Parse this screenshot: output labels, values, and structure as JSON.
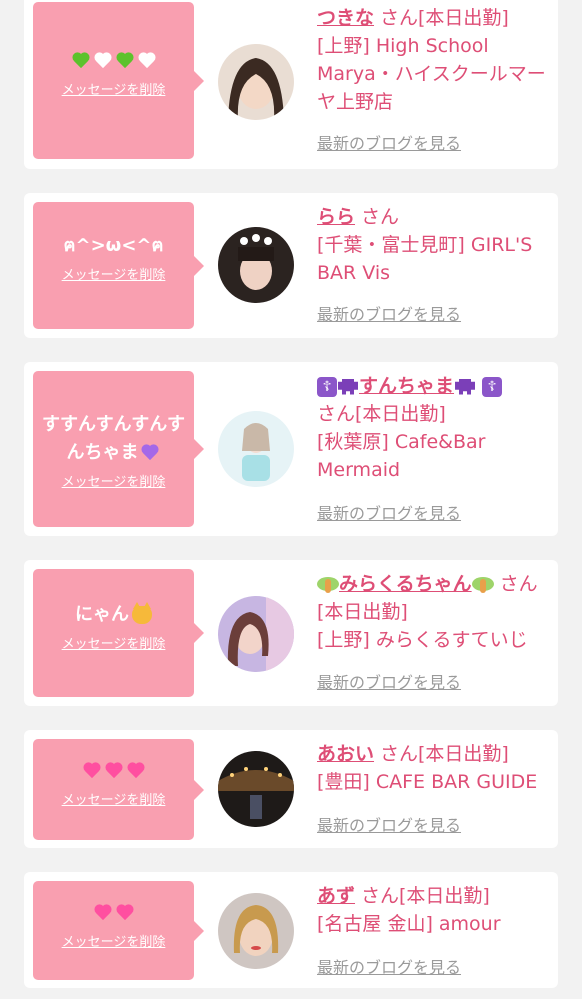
{
  "common": {
    "delete_label": "メッセージを削除",
    "blog_label": "最新のブログを見る",
    "san": "さん",
    "today": "[本日出勤]"
  },
  "entries": [
    {
      "message": "",
      "message_icons": [
        "green-heart",
        "white-heart",
        "green-heart",
        "white-heart"
      ],
      "name": "つきな",
      "suffix": "さん[本日出勤]",
      "shop": "[上野] High School Marya・ハイスクールマーヤ上野店"
    },
    {
      "message": "ฅ^>ω<^ฅ",
      "message_icons": [],
      "name": "らら",
      "suffix": "さん",
      "shop": "[千葉・富士見町] GIRL'S BAR Vis"
    },
    {
      "message": "すすんすんすんすんちゃま",
      "message_icons": [
        "purple-heart"
      ],
      "name": "すんちゃま",
      "suffix": "さん[本日出勤]",
      "shop": "[秋葉原] Cafe&Bar Mermaid"
    },
    {
      "message": "にゃん",
      "message_icons": [
        "cat-face"
      ],
      "name": "みらくるちゃん",
      "suffix": "さん[本日出勤]",
      "shop": "[上野] みらくるすていじ"
    },
    {
      "message": "",
      "message_icons": [
        "revolving-hearts",
        "revolving-hearts",
        "revolving-hearts"
      ],
      "name": "あおい",
      "suffix": "さん[本日出勤]",
      "shop": "[豊田] CAFE BAR GUIDE"
    },
    {
      "message": "",
      "message_icons": [
        "sparkling-heart",
        "sparkling-heart"
      ],
      "name": "あず",
      "suffix": "さん[本日出勤]",
      "shop": "[名古屋 金山] amour"
    }
  ],
  "colors": {
    "background": "#f2f2f2",
    "bubble": "#f99fb0",
    "accent": "#de4e76",
    "link_gray": "#9a9a9a"
  }
}
